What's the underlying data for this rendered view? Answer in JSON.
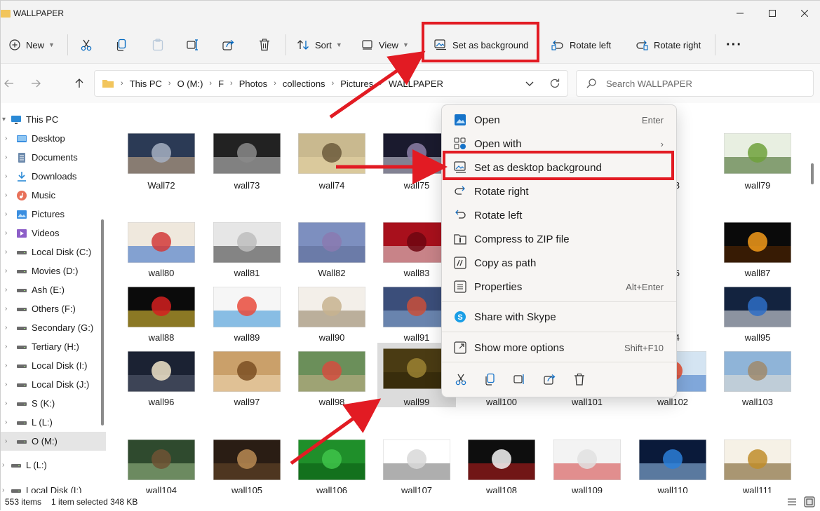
{
  "window": {
    "title": "WALLPAPER"
  },
  "toolbar": {
    "new_label": "New",
    "sort_label": "Sort",
    "view_label": "View",
    "set_bg_label": "Set as background",
    "rotate_left_label": "Rotate left",
    "rotate_right_label": "Rotate right",
    "more_label": "···"
  },
  "address": {
    "crumbs": [
      "This PC",
      "O (M:)",
      "F",
      "Photos",
      "collections",
      "Pictures",
      "WALLPAPER"
    ],
    "search_placeholder": "Search WALLPAPER"
  },
  "sidebar": {
    "items": [
      {
        "label": "This PC",
        "icon": "monitor-icon"
      },
      {
        "label": "Desktop",
        "icon": "desktop-folder-icon"
      },
      {
        "label": "Documents",
        "icon": "documents-icon"
      },
      {
        "label": "Downloads",
        "icon": "download-icon"
      },
      {
        "label": "Music",
        "icon": "music-icon"
      },
      {
        "label": "Pictures",
        "icon": "pictures-icon"
      },
      {
        "label": "Videos",
        "icon": "videos-icon"
      },
      {
        "label": "Local Disk (C:)",
        "icon": "drive-icon"
      },
      {
        "label": "Movies (D:)",
        "icon": "drive-icon"
      },
      {
        "label": "Ash (E:)",
        "icon": "drive-icon"
      },
      {
        "label": "Others (F:)",
        "icon": "drive-icon"
      },
      {
        "label": "Secondary (G:)",
        "icon": "drive-icon"
      },
      {
        "label": "Tertiary (H:)",
        "icon": "drive-icon"
      },
      {
        "label": "Local Disk (I:)",
        "icon": "drive-icon"
      },
      {
        "label": "Local Disk (J:)",
        "icon": "drive-icon"
      },
      {
        "label": "S (K:)",
        "icon": "drive-icon"
      },
      {
        "label": "L (L:)",
        "icon": "drive-icon"
      },
      {
        "label": "O (M:)",
        "icon": "drive-icon"
      },
      {
        "label": "L (L:)",
        "icon": "drive-icon"
      },
      {
        "label": "Local Disk (I:)",
        "icon": "drive-icon"
      }
    ]
  },
  "files": [
    {
      "name": "Wall72",
      "colors": [
        "#2b3a55",
        "#a6b0c2",
        "#d6b28a"
      ]
    },
    {
      "name": "wall73",
      "colors": [
        "#222222",
        "#8a8a8a",
        "#cfcfcf"
      ]
    },
    {
      "name": "wall74",
      "colors": [
        "#c9b98f",
        "#6c5a3c",
        "#e8d7a8"
      ]
    },
    {
      "name": "wall75",
      "colors": [
        "#1a1a2e",
        "#8c7fa6",
        "#d9d9e8"
      ]
    },
    {
      "name": "78",
      "colors": [
        "#f5f5f5",
        "#ffffff",
        "#cc2222"
      ]
    },
    {
      "name": "wall79",
      "colors": [
        "#e8efe1",
        "#6fa13b",
        "#335d1a"
      ]
    },
    {
      "name": "wall80",
      "colors": [
        "#efe8dd",
        "#d23a3a",
        "#2a66c6"
      ]
    },
    {
      "name": "wall81",
      "colors": [
        "#e6e6e6",
        "#bdbdbd",
        "#333333"
      ]
    },
    {
      "name": "Wall82",
      "colors": [
        "#7d8fbf",
        "#8a7ab0",
        "#5d6b96"
      ]
    },
    {
      "name": "wall83",
      "colors": [
        "#a8101c",
        "#6e0610",
        "#e2e2e2"
      ]
    },
    {
      "name": "86",
      "colors": [
        "#101010",
        "#2e6a3a",
        "#e7d36b"
      ]
    },
    {
      "name": "wall87",
      "colors": [
        "#0a0a0a",
        "#f29a1a",
        "#5c2a00"
      ]
    },
    {
      "name": "wall88",
      "colors": [
        "#0b0b0b",
        "#d42020",
        "#f5d33a"
      ]
    },
    {
      "name": "wall89",
      "colors": [
        "#f6f6f6",
        "#e94b3c",
        "#2d8ed6"
      ]
    },
    {
      "name": "wall90",
      "colors": [
        "#f3efe9",
        "#c7b38f",
        "#8c7a5b"
      ]
    },
    {
      "name": "wall91",
      "colors": [
        "#3b4e7a",
        "#c94f3a",
        "#8fb0d9"
      ]
    },
    {
      "name": "94",
      "colors": [
        "#f2f2f2",
        "#e6e6e6",
        "#bcbcbc"
      ]
    },
    {
      "name": "wall95",
      "colors": [
        "#13233f",
        "#2e6dc6",
        "#f0f0f0"
      ]
    },
    {
      "name": "wall96",
      "colors": [
        "#1b2233",
        "#f0e4c9",
        "#5a6072"
      ]
    },
    {
      "name": "wall97",
      "colors": [
        "#caa06a",
        "#7b4f22",
        "#f3ddb8"
      ]
    },
    {
      "name": "wall98",
      "colors": [
        "#6b8f5a",
        "#d34e3f",
        "#c9b58b"
      ]
    },
    {
      "name": "wall99",
      "colors": [
        "#4a3b13",
        "#9b8233",
        "#2c2308"
      ]
    },
    {
      "name": "wall100",
      "colors": [
        "#ffffff",
        "#ffffff",
        "#ffffff"
      ]
    },
    {
      "name": "wall101",
      "colors": [
        "#ffffff",
        "#ffffff",
        "#ffffff"
      ]
    },
    {
      "name": "wall102",
      "colors": [
        "#d4e4f2",
        "#e54b2f",
        "#3a74c6"
      ]
    },
    {
      "name": "wall103",
      "colors": [
        "#8fb4d8",
        "#a08a6c",
        "#e7e2d9"
      ]
    },
    {
      "name": "wall104",
      "colors": [
        "#2f4a2e",
        "#6e5234",
        "#9fbf8a"
      ]
    },
    {
      "name": "wall105",
      "colors": [
        "#2a1d14",
        "#b88a52",
        "#6b4a2a"
      ]
    },
    {
      "name": "wall106",
      "colors": [
        "#1f8f2a",
        "#3fc44a",
        "#0a5a12"
      ]
    },
    {
      "name": "wall107",
      "colors": [
        "#ffffff",
        "#d8d8d8",
        "#6b6b6b"
      ]
    },
    {
      "name": "wall108",
      "colors": [
        "#0e0e0e",
        "#f5f5f5",
        "#c21d1d"
      ]
    },
    {
      "name": "wall109",
      "colors": [
        "#f3f3f3",
        "#e0e0e0",
        "#d13a3a"
      ]
    },
    {
      "name": "wall110",
      "colors": [
        "#0a1a3a",
        "#2b7fd8",
        "#9cc9f2"
      ]
    },
    {
      "name": "wall111",
      "colors": [
        "#f6f1e6",
        "#c08d2a",
        "#6a4a12"
      ]
    }
  ],
  "context_menu": {
    "items": [
      {
        "label": "Open",
        "shortcut": "Enter",
        "icon": "photos-app-icon"
      },
      {
        "label": "Open with",
        "shortcut": "›",
        "icon": "open-with-icon"
      },
      {
        "label": "Set as desktop background",
        "shortcut": "",
        "icon": "set-background-icon"
      },
      {
        "label": "Rotate right",
        "shortcut": "",
        "icon": "rotate-right-icon"
      },
      {
        "label": "Rotate left",
        "shortcut": "",
        "icon": "rotate-left-icon"
      },
      {
        "label": "Compress to ZIP file",
        "shortcut": "",
        "icon": "zip-folder-icon"
      },
      {
        "label": "Copy as path",
        "shortcut": "",
        "icon": "copy-path-icon"
      },
      {
        "label": "Properties",
        "shortcut": "Alt+Enter",
        "icon": "properties-icon"
      },
      {
        "label": "Share with Skype",
        "shortcut": "",
        "icon": "skype-icon"
      },
      {
        "label": "Show more options",
        "shortcut": "Shift+F10",
        "icon": "more-options-icon"
      }
    ],
    "bottom_icons": [
      "cut-icon",
      "copy-icon",
      "rename-icon",
      "share-icon",
      "delete-icon"
    ]
  },
  "status": {
    "count": "553 items",
    "selection": "1 item selected  348 KB"
  },
  "colors": {
    "highlight": "#e21b23",
    "accent": "#0067c0",
    "folder": "#f2c55c"
  }
}
